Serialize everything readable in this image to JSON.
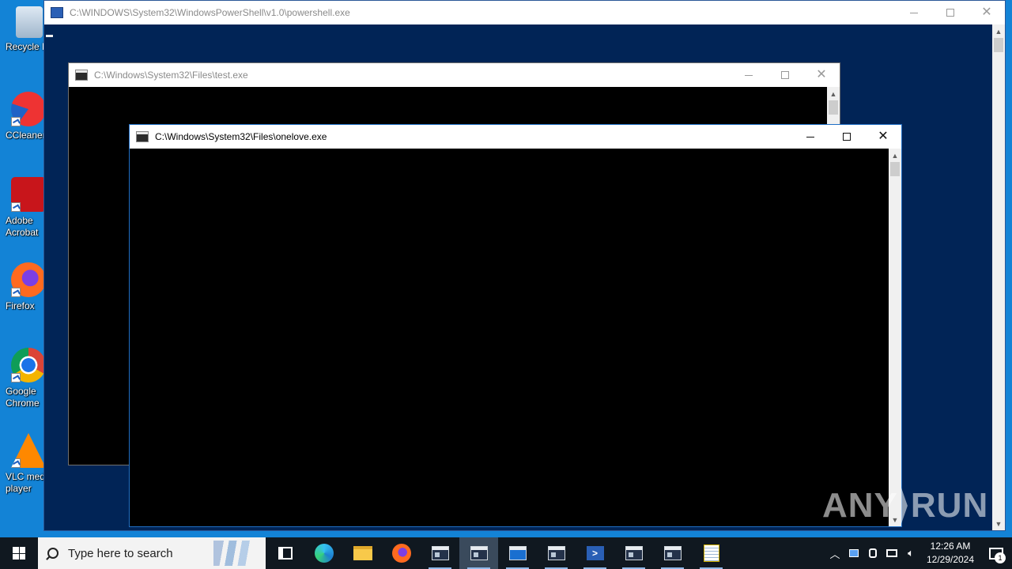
{
  "desktop": {
    "icons": [
      {
        "label": "Recycle Bin"
      },
      {
        "label": "CCleaner"
      },
      {
        "label": "Adobe\nAcrobat"
      },
      {
        "label": "Firefox"
      },
      {
        "label": "Google\nChrome"
      },
      {
        "label": "VLC media\nplayer"
      }
    ]
  },
  "windows": {
    "powershell": {
      "title": "C:\\WINDOWS\\System32\\WindowsPowerShell\\v1.0\\powershell.exe",
      "background": "#012456"
    },
    "test": {
      "title": "C:\\Windows\\System32\\Files\\test.exe"
    },
    "onelove": {
      "title": "C:\\Windows\\System32\\Files\\onelove.exe"
    }
  },
  "caption": {
    "minimize": "—",
    "maximize": "☐",
    "close": "✕"
  },
  "watermark": {
    "text_left": "ANY",
    "text_right": "RUN"
  },
  "taskbar": {
    "search_placeholder": "Type here to search",
    "apps": [
      "task-view",
      "edge",
      "file-explorer",
      "firefox",
      "console",
      "console",
      "console",
      "console",
      "powershell",
      "console",
      "console",
      "notepad"
    ],
    "clock_time": "12:26 AM",
    "clock_date": "12/29/2024",
    "notification_count": "1"
  },
  "colors": {
    "desktop": "#1383d6",
    "taskbar": "#101820",
    "console_bg": "#000000"
  }
}
